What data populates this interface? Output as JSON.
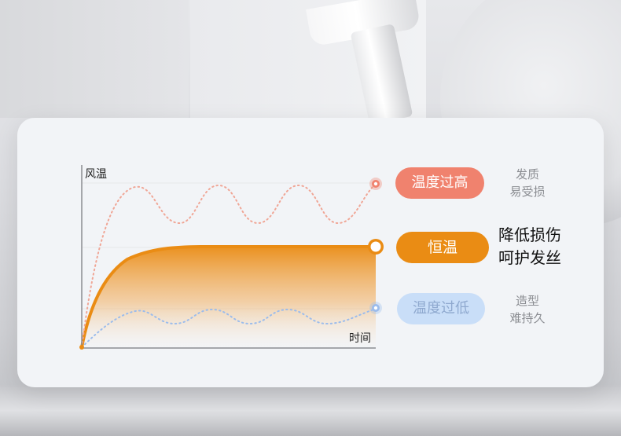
{
  "chart": {
    "y_axis_label": "风温",
    "x_axis_label": "时间"
  },
  "chart_data": {
    "type": "line",
    "xlabel": "时间",
    "ylabel": "风温",
    "series": [
      {
        "label": "温度过高",
        "style": "dotted",
        "color": "#f0826e"
      },
      {
        "label": "恒温",
        "style": "solid-filled",
        "color": "#ea8c14"
      },
      {
        "label": "温度过低",
        "style": "dotted",
        "color": "#9bbcec"
      }
    ]
  },
  "legend": {
    "high": {
      "label": "温度过高",
      "desc_line1": "发质",
      "desc_line2": "易受损"
    },
    "constant": {
      "label": "恒温",
      "desc_line1": "降低损伤",
      "desc_line2": "呵护发丝"
    },
    "low": {
      "label": "温度过低",
      "desc_line1": "造型",
      "desc_line2": "难持久"
    }
  },
  "colors": {
    "high": "#f0826e",
    "constant": "#ea8c14",
    "low": "#9bbcec",
    "card": "#f2f4f7"
  }
}
